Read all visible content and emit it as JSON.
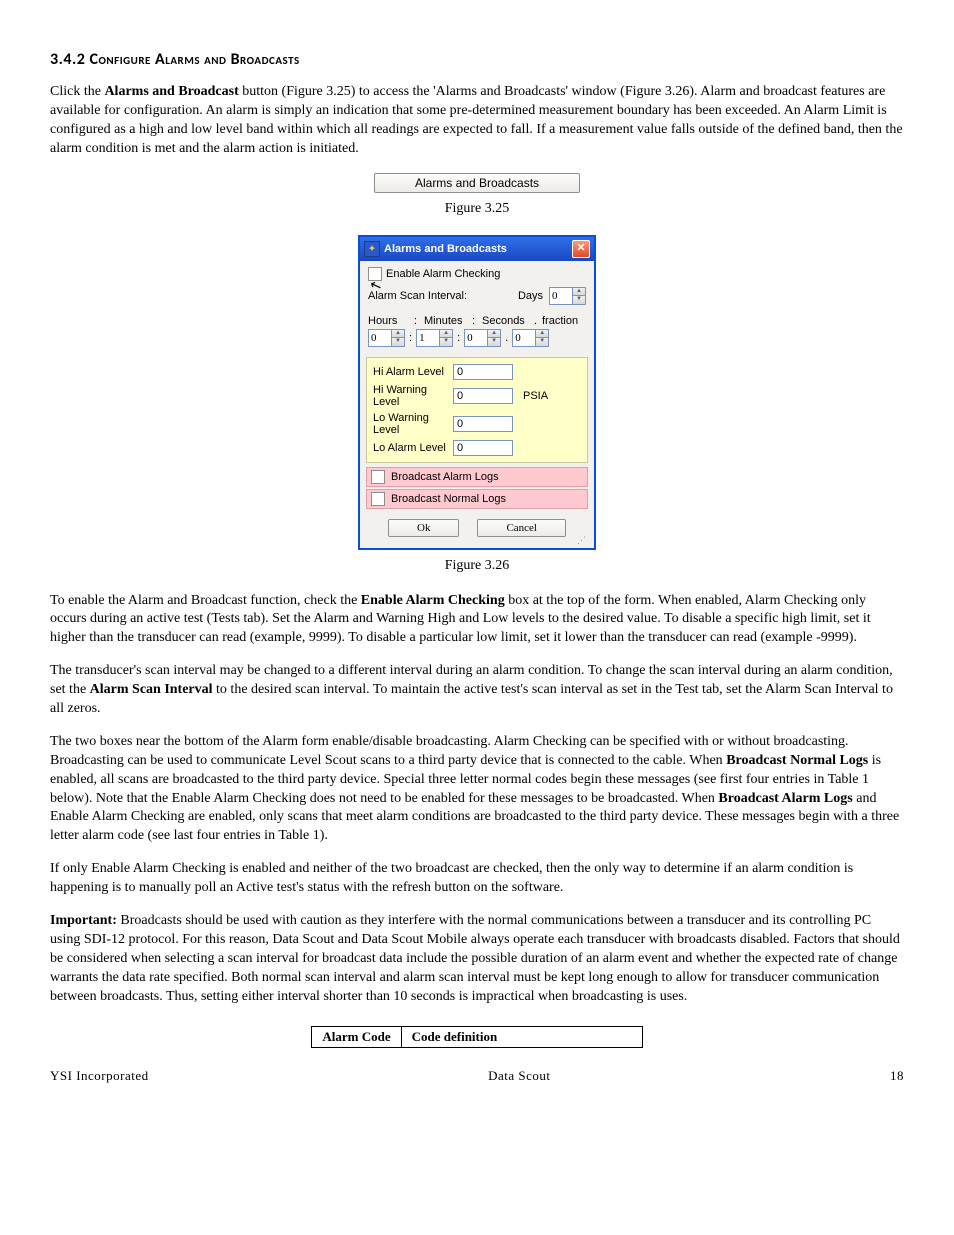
{
  "heading": "3.4.2 Configure Alarms and Broadcasts",
  "para1_a": "Click the ",
  "para1_b": "Alarms and Broadcast",
  "para1_c": " button (Figure 3.25) to access the 'Alarms and Broadcasts' window (Figure 3.26). Alarm and broadcast features are available for configuration. An alarm is simply an indication that some pre-determined measurement boundary has been exceeded. An Alarm Limit is configured as a high and low level band within which all readings are expected to fall. If a measurement value falls outside of the defined band, then the alarm condition is met and the alarm action is initiated.",
  "fig325_button": "Alarms and Broadcasts",
  "fig325_caption": "Figure 3.25",
  "dialog": {
    "title": "Alarms and Broadcasts",
    "enable_label": "Enable Alarm Checking",
    "scan_interval_label": "Alarm Scan Interval:",
    "days_label": "Days",
    "days_value": "0",
    "time_hdr_hours": "Hours",
    "time_hdr_minutes": "Minutes",
    "time_hdr_seconds": "Seconds",
    "time_hdr_fraction": "fraction",
    "hours": "0",
    "minutes": "1",
    "seconds": "0",
    "fraction": "0",
    "hi_alarm_label": "Hi Alarm Level",
    "hi_alarm_val": "0",
    "hi_warn_label": "Hi Warning Level",
    "hi_warn_val": "0",
    "lo_warn_label": "Lo Warning Level",
    "lo_warn_val": "0",
    "lo_alarm_label": "Lo Alarm Level",
    "lo_alarm_val": "0",
    "unit": "PSIA",
    "broadcast_alarm": "Broadcast Alarm Logs",
    "broadcast_normal": "Broadcast Normal Logs",
    "ok": "Ok",
    "cancel": "Cancel"
  },
  "fig326_caption": "Figure 3.26",
  "para2_a": "To enable the Alarm and Broadcast function, check the ",
  "para2_b": "Enable Alarm Checking",
  "para2_c": " box at the top of the form. When enabled, Alarm Checking only occurs during an active test (Tests tab). Set the Alarm and Warning High and Low levels to the desired value. To disable a specific high limit, set it higher than the transducer can read (example, 9999).  To disable a particular low limit, set it lower than the transducer can read (example -9999).",
  "para3_a": "The transducer's scan interval may be changed to a different interval during an alarm condition. To change the scan interval during an alarm condition, set the ",
  "para3_b": "Alarm Scan Interval",
  "para3_c": " to the desired scan interval. To maintain the active test's scan interval as set in the Test tab, set the Alarm Scan Interval to all zeros.",
  "para4_a": "The two boxes near the bottom of the Alarm form enable/disable broadcasting. Alarm Checking can be specified with or without broadcasting. Broadcasting can be used to communicate Level Scout scans to a third party device that is connected to the cable. When ",
  "para4_b": "Broadcast Normal Logs",
  "para4_c": " is enabled, all scans are broadcasted to the third party device. Special three letter normal codes begin these messages (see first four entries in Table 1 below). Note that the Enable Alarm Checking does not need to be enabled for these messages to be broadcasted. When ",
  "para4_d": "Broadcast Alarm Logs",
  "para4_e": " and Enable Alarm Checking are enabled, only scans that meet alarm conditions are broadcasted to the third party device. These messages begin with a three letter alarm code (see last four entries in Table 1).",
  "para5": "If only Enable Alarm Checking is enabled and neither of the two broadcast are checked, then the only way to determine if an alarm condition is happening is to manually poll an Active test's status with the refresh button on the software.",
  "para6_a": "Important:",
  "para6_b": "  Broadcasts should be used with caution as they interfere with the normal communications between a transducer and its controlling PC using SDI-12 protocol. For this reason, Data Scout and Data Scout Mobile always operate each transducer with broadcasts disabled. Factors that should be considered when selecting a scan interval for broadcast data include the possible duration of an alarm event and whether the expected rate of change warrants the data rate specified. Both normal scan interval and alarm scan interval must be kept long enough to allow for transducer communication between broadcasts. Thus, setting either interval shorter than 10 seconds is impractical when broadcasting is uses.",
  "table": {
    "col1": "Alarm Code",
    "col2": "Code definition"
  },
  "footer": {
    "left": "YSI Incorporated",
    "center": "Data Scout",
    "right": "18"
  }
}
